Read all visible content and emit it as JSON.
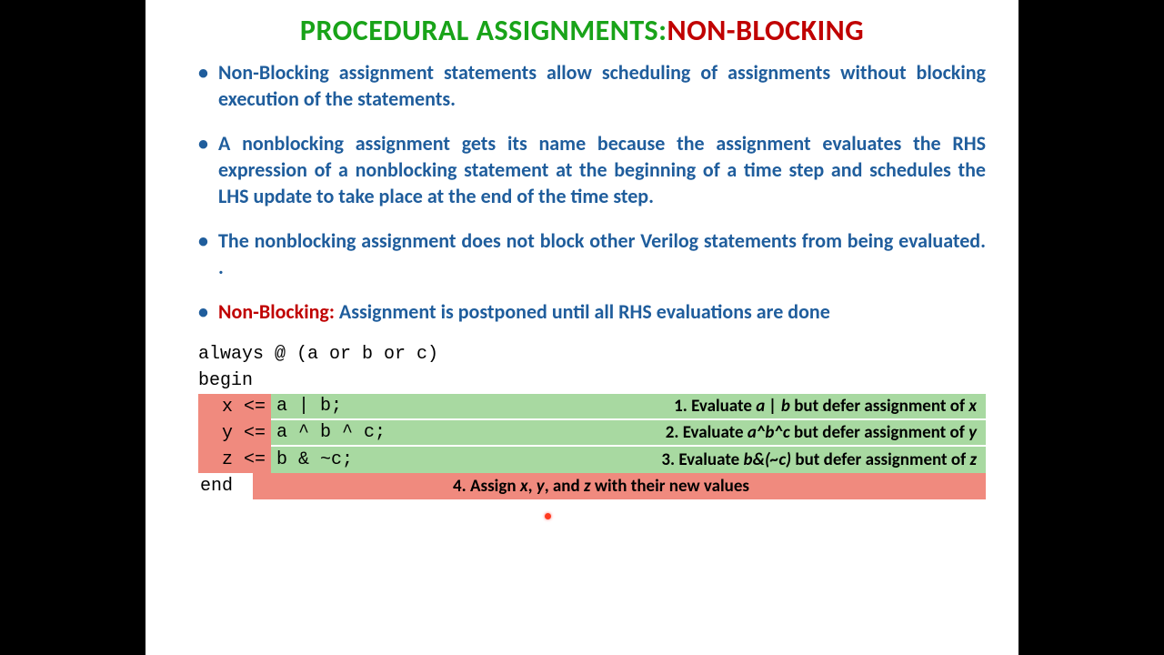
{
  "title": {
    "part1": "PROCEDURAL ASSIGNMENTS:",
    "part2": "NON-BLOCKING"
  },
  "bullets": {
    "b1": "Non-Blocking assignment statements allow scheduling of assignments without blocking execution of the statements.",
    "b2": "A nonblocking assignment gets its name because the assignment evaluates the RHS expression of a nonblocking statement at the beginning of a time step and schedules the LHS update to take place at the end of the time step.",
    "b3": "The nonblocking assignment does not block other Verilog statements from being evaluated. .",
    "b4_prefix": "Non-Blocking:",
    "b4_rest": " Assignment is postponed until all RHS evaluations are done"
  },
  "code": {
    "header": "always @ (a or b or c)",
    "begin": "begin",
    "end": "end",
    "rows": [
      {
        "lhs": "x <=",
        "rhs": "a | b;"
      },
      {
        "lhs": "y <=",
        "rhs": "a ^ b ^ c;"
      },
      {
        "lhs": "z <=",
        "rhs": "b & ~c;"
      }
    ],
    "notes": {
      "n1a": "1. Evaluate ",
      "n1b": "a | b",
      "n1c": " but defer assignment of ",
      "n1d": "x",
      "n2a": "2. Evaluate ",
      "n2b": "a^b^c",
      "n2c": "  but defer assignment of ",
      "n2d": "y",
      "n3a": "3. Evaluate ",
      "n3b": "b&(~c)",
      "n3c": " but defer assignment of ",
      "n3d": "z",
      "n4a": "4. Assign ",
      "n4b": "x",
      "n4c": ", ",
      "n4d": "y",
      "n4e": ", and ",
      "n4f": "z",
      "n4g": " with their new values"
    }
  }
}
